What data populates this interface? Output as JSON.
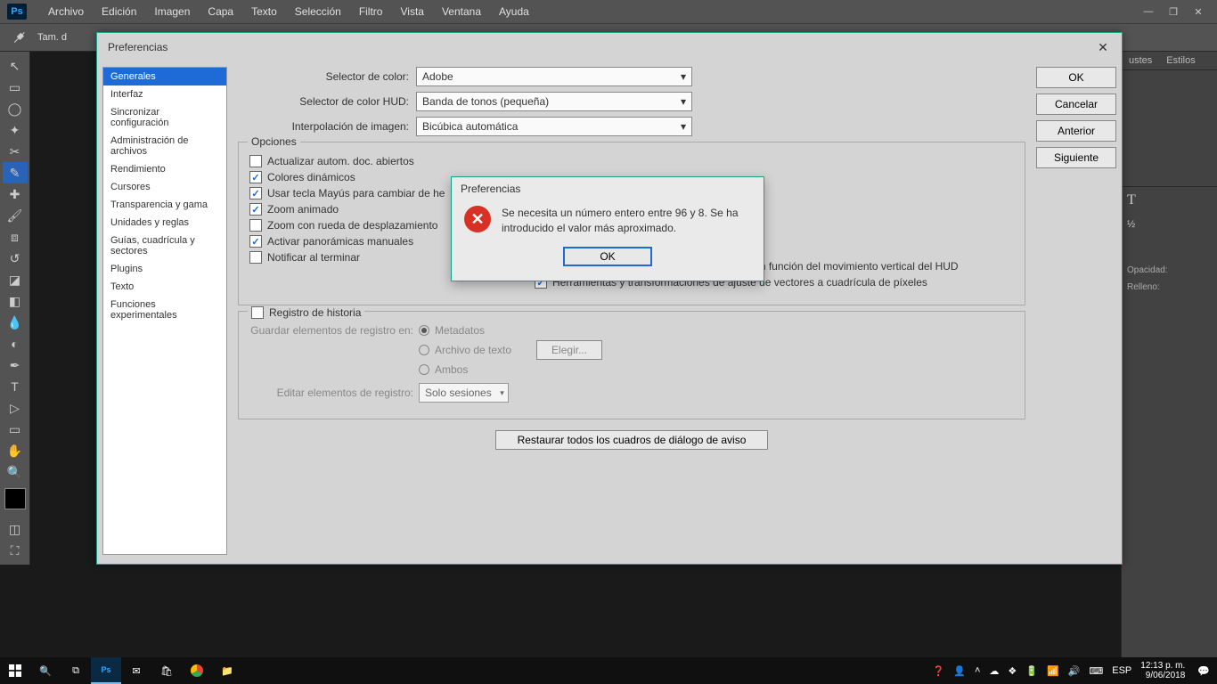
{
  "menubar": {
    "items": [
      "Archivo",
      "Edición",
      "Imagen",
      "Capa",
      "Texto",
      "Selección",
      "Filtro",
      "Vista",
      "Ventana",
      "Ayuda"
    ]
  },
  "optionsbar": {
    "sample_label": "Tam. d"
  },
  "right_panels": {
    "tab1": "ustes",
    "tab2": "Estilos",
    "opacity": "Opacidad:",
    "fill": "Relleno:"
  },
  "prefs": {
    "title": "Preferencias",
    "sidebar": [
      "Generales",
      "Interfaz",
      "Sincronizar configuración",
      "Administración de archivos",
      "Rendimiento",
      "Cursores",
      "Transparencia y gama",
      "Unidades y reglas",
      "Guías, cuadrícula y sectores",
      "Plugins",
      "Texto",
      "Funciones experimentales"
    ],
    "buttons": {
      "ok": "OK",
      "cancel": "Cancelar",
      "prev": "Anterior",
      "next": "Siguiente"
    },
    "row1": {
      "label": "Selector de color:",
      "value": "Adobe"
    },
    "row2": {
      "label": "Selector de color HUD:",
      "value": "Banda de tonos (pequeña)"
    },
    "row3": {
      "label": "Interpolación de imagen:",
      "value": "Bicúbica automática"
    },
    "fieldset_options": "Opciones",
    "checks_left": [
      {
        "label": "Actualizar autom. doc. abiertos",
        "checked": false
      },
      {
        "label": "Colores dinámicos",
        "checked": true
      },
      {
        "label": "Usar tecla Mayús para cambiar de he",
        "checked": true
      },
      {
        "label": "Zoom animado",
        "checked": true
      },
      {
        "label": "Zoom con rueda de desplazamiento",
        "checked": false
      },
      {
        "label": "Activar panorámicas manuales",
        "checked": true
      },
      {
        "label": "Notificar al terminar",
        "checked": false
      }
    ],
    "checks_right": [
      {
        "label": "Cambiar dureza de pinceles redondeados en función del movimiento vertical del HUD",
        "checked": true
      },
      {
        "label": "Herramientas y transformaciones de ajuste de vectores a cuadrícula de píxeles",
        "checked": true
      }
    ],
    "history": {
      "title": "Registro de historia",
      "save_label": "Guardar elementos de registro en:",
      "r1": "Metadatos",
      "r2": "Archivo de texto",
      "r3": "Ambos",
      "choose": "Elegir...",
      "edit_label": "Editar elementos de registro:",
      "edit_value": "Solo sesiones"
    },
    "restore": "Restaurar todos los cuadros de diálogo de aviso"
  },
  "alert": {
    "title": "Preferencias",
    "message": "Se necesita un número entero entre 96 y 8. Se ha introducido el valor más aproximado.",
    "ok": "OK"
  },
  "taskbar": {
    "lang": "ESP",
    "time": "12:13 p. m.",
    "date": "9/06/2018"
  }
}
